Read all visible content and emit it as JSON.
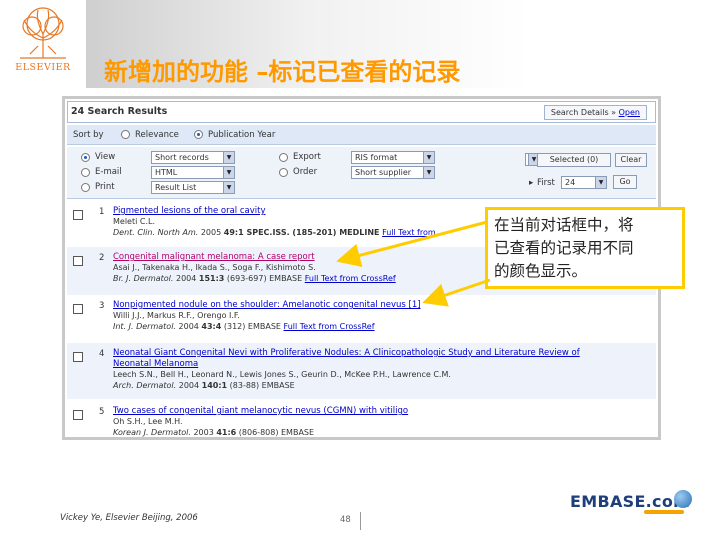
{
  "slide": {
    "logo_text": "ELSEVIER",
    "title": "新增加的功能 –标记已查看的记录",
    "credit": "Vickey Ye, Elsevier Beijing, 2006",
    "page_number": "48",
    "brand": "EMBASE.com"
  },
  "callout": {
    "lines": [
      "在当前对话框中，将",
      "已查看的记录用不同",
      "的颜色显示。"
    ],
    "border_color": "#ffcc00"
  },
  "results": {
    "count_label": "24 Search Results",
    "search_details_label": "Search Details »",
    "open_label": "Open"
  },
  "sort": {
    "label": "Sort by",
    "options": [
      {
        "label": "Relevance",
        "selected": false
      },
      {
        "label": "Publication Year",
        "selected": true
      }
    ]
  },
  "output": {
    "view": {
      "label": "View",
      "selected": true
    },
    "email": {
      "label": "E-mail",
      "selected": false
    },
    "print": {
      "label": "Print",
      "selected": false
    },
    "format_selects": [
      "Short records",
      "HTML",
      "Result List"
    ],
    "export": {
      "label": "Export",
      "selected": false
    },
    "order": {
      "label": "Order",
      "selected": false
    },
    "export_selects": [
      "RIS format",
      "Short supplier"
    ],
    "selected_button": "Selected (0)",
    "clear_button": "Clear",
    "first_label": "First",
    "first_value": "24",
    "go_button": "Go"
  },
  "records": [
    {
      "num": "1",
      "title": "Pigmented lesions of the oral cavity",
      "title_cont": "",
      "visited": false,
      "authors": "Meleti C.L.",
      "journal": "Dent. Clin. North Am.",
      "year_vol": "2005",
      "volume": "49:1",
      "rest": " SPEC.ISS. (185-201) MEDLINE",
      "fulltext": "Full Text from"
    },
    {
      "num": "2",
      "title": "Congenital malignant melanoma: A case report",
      "title_cont": "",
      "visited": true,
      "authors": "Asai J., Takenaka H., Ikada S., Soga F., Kishimoto S.",
      "journal": "Br. J. Dermatol.",
      "year_vol": "2004",
      "volume": "151:3",
      "rest": " (693-697) EMBASE",
      "fulltext": "Full Text from CrossRef"
    },
    {
      "num": "3",
      "title": "Nonpigmented nodule on the shoulder: Amelanotic congenital nevus [1]",
      "title_cont": "",
      "visited": false,
      "authors": "Willi J.J., Markus R.F., Orengo I.F.",
      "journal": "Int. J. Dermatol.",
      "year_vol": "2004",
      "volume": "43:4",
      "rest": " (312) EMBASE",
      "fulltext": "Full Text from CrossRef"
    },
    {
      "num": "4",
      "title": "Neonatal Giant Congenital Nevi with Proliferative Nodules: A Clinicopathologic Study and Literature Review of",
      "title_cont": "Neonatal Melanoma",
      "visited": false,
      "authors": "Leech S.N., Bell H., Leonard N., Lewis Jones S., Geurin D., McKee P.H., Lawrence C.M.",
      "journal": "Arch. Dermatol.",
      "year_vol": "2004",
      "volume": "140:1",
      "rest": " (83-88) EMBASE",
      "fulltext": ""
    },
    {
      "num": "5",
      "title": "Two cases of congenital giant melanocytic nevus (CGMN) with vitiligo",
      "title_cont": "",
      "visited": false,
      "authors": "Oh S.H., Lee M.H.",
      "journal": "Korean J. Dermatol.",
      "year_vol": "2003",
      "volume": "41:6",
      "rest": " (806-808) EMBASE",
      "fulltext": ""
    }
  ],
  "colors": {
    "title_orange": "#ff9900",
    "visited_link": "#b3006b",
    "link": "#0000cc",
    "arrow_yellow": "#ffcc00"
  }
}
